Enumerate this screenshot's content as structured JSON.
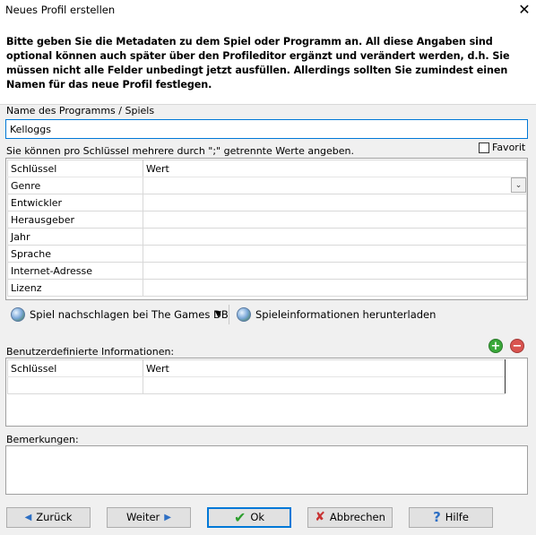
{
  "window": {
    "title": "Neues Profil erstellen",
    "close": "✕"
  },
  "intro": {
    "text": "Bitte geben Sie die Metadaten zu dem Spiel oder Programm an. All diese Angaben sind optional können auch später über den Profileditor ergänzt und verändert werden, d.h. Sie müssen nicht alle Felder unbedingt jetzt ausfüllen. Allerdings sollten Sie zumindest einen Namen für das neue Profil festlegen."
  },
  "name": {
    "label": "Name des Programms / Spiels",
    "value": "Kelloggs"
  },
  "hint": "Sie können pro Schlüssel mehrere durch \";\" getrennte Werte angeben.",
  "favorit": {
    "label": "Favorit",
    "checked": false
  },
  "meta_table": {
    "headers": [
      "Schlüssel",
      "Wert"
    ],
    "rows": [
      {
        "key": "Genre",
        "value": ""
      },
      {
        "key": "Entwickler",
        "value": ""
      },
      {
        "key": "Herausgeber",
        "value": ""
      },
      {
        "key": "Jahr",
        "value": ""
      },
      {
        "key": "Sprache",
        "value": ""
      },
      {
        "key": "Internet-Adresse",
        "value": ""
      },
      {
        "key": "Lizenz",
        "value": ""
      }
    ]
  },
  "toolbar": {
    "lookup_label": "Spiel nachschlagen bei The Games DB",
    "download_label": "Spieleinformationen herunterladen"
  },
  "custom": {
    "label": "Benutzerdefinierte Informationen:",
    "headers": [
      "Schlüssel",
      "Wert"
    ]
  },
  "notes": {
    "label": "Bemerkungen:",
    "value": ""
  },
  "buttons": {
    "back": "Zurück",
    "next": "Weiter",
    "ok": "Ok",
    "cancel": "Abbrechen",
    "help": "Hilfe"
  },
  "colors": {
    "accent": "#0078d7",
    "add": "#3aa83a",
    "remove": "#d9534f"
  }
}
